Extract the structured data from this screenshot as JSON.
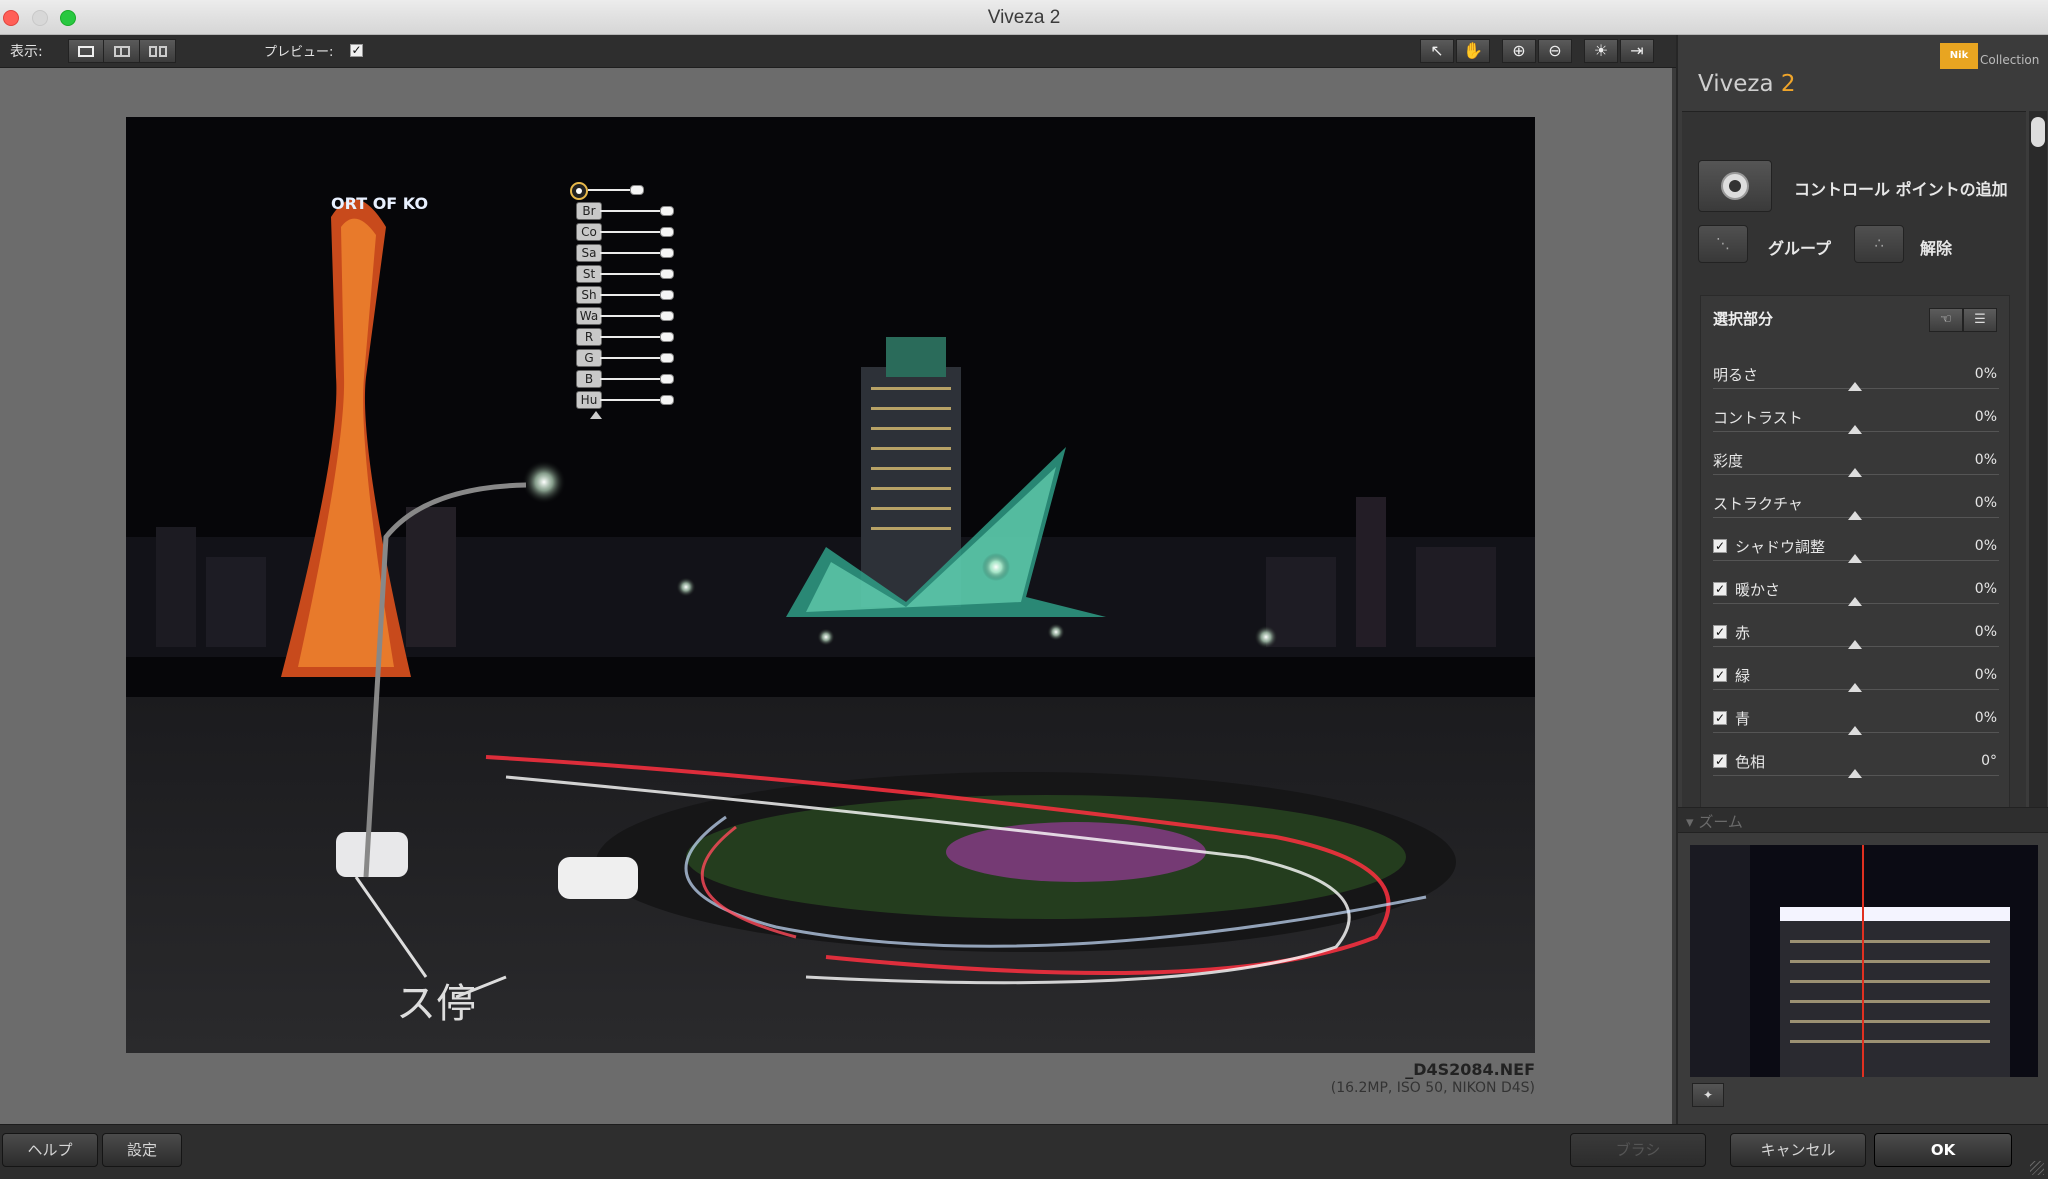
{
  "window": {
    "title": "Viveza 2"
  },
  "toolbar": {
    "view_label": "表示:",
    "preview_label": "プレビュー:",
    "preview_checked": true,
    "tools": [
      {
        "name": "arrow-icon",
        "glyph": "↖"
      },
      {
        "name": "hand-icon",
        "glyph": "✋"
      },
      {
        "name": "zoom-in-icon",
        "glyph": "⊕"
      },
      {
        "name": "zoom-out-icon",
        "glyph": "⊖"
      },
      {
        "name": "light-icon",
        "glyph": "☀"
      },
      {
        "name": "export-icon",
        "glyph": "⇥"
      }
    ]
  },
  "image": {
    "file_name": "_D4S2084.NEF",
    "file_meta": "(16.2MP, ISO 50, NIKON D4S)"
  },
  "control_point": {
    "labels": [
      "Br",
      "Co",
      "Sa",
      "St",
      "Sh",
      "Wa",
      "R",
      "G",
      "B",
      "Hu"
    ]
  },
  "panel": {
    "brand": "Viveza",
    "brand_num": "2",
    "nik_badge": "Nik",
    "nik_collection": "Collection",
    "add_control_point": "コントロール ポイントの追加",
    "group": "グループ",
    "ungroup": "解除",
    "selection_title": "選択部分",
    "adjustments": [
      {
        "name": "明るさ",
        "value": "0%",
        "checkbox": false
      },
      {
        "name": "コントラスト",
        "value": "0%",
        "checkbox": false
      },
      {
        "name": "彩度",
        "value": "0%",
        "checkbox": false
      },
      {
        "name": "ストラクチャ",
        "value": "0%",
        "checkbox": false
      },
      {
        "name": "シャドウ調整",
        "value": "0%",
        "checkbox": true
      },
      {
        "name": "暖かさ",
        "value": "0%",
        "checkbox": true
      },
      {
        "name": "赤",
        "value": "0%",
        "checkbox": true
      },
      {
        "name": "緑",
        "value": "0%",
        "checkbox": true
      },
      {
        "name": "青",
        "value": "0%",
        "checkbox": true
      },
      {
        "name": "色相",
        "value": "0°",
        "checkbox": true
      }
    ],
    "zoom_label": "ズーム"
  },
  "bottom": {
    "help": "ヘルプ",
    "settings": "設定",
    "brush": "ブラシ",
    "cancel": "キャンセル",
    "ok": "OK"
  },
  "colors": {
    "accent": "#f0a52a",
    "nik_yellow": "#e8a521"
  }
}
